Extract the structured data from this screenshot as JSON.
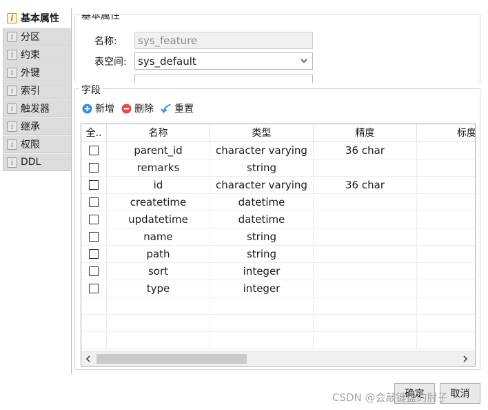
{
  "tabs": [
    {
      "label": "基本属性",
      "active": true,
      "icon": "info-icon"
    },
    {
      "label": "分区",
      "active": false,
      "icon": "info-icon"
    },
    {
      "label": "约束",
      "active": false,
      "icon": "info-icon"
    },
    {
      "label": "外键",
      "active": false,
      "icon": "info-icon"
    },
    {
      "label": "索引",
      "active": false,
      "icon": "info-icon"
    },
    {
      "label": "触发器",
      "active": false,
      "icon": "info-icon"
    },
    {
      "label": "继承",
      "active": false,
      "icon": "info-icon"
    },
    {
      "label": "权限",
      "active": false,
      "icon": "info-icon"
    },
    {
      "label": "DDL",
      "active": false,
      "icon": "info-icon"
    }
  ],
  "basic": {
    "legend": "基本属性",
    "name_label": "名称:",
    "name_value": "sys_feature",
    "tablespace_label": "表空间:",
    "tablespace_value": "sys_default"
  },
  "fields": {
    "legend": "字段",
    "toolbar": {
      "add": "新增",
      "delete": "删除",
      "reset": "重置"
    },
    "columns": [
      "全..",
      "名称",
      "类型",
      "精度",
      "标度"
    ],
    "rows": [
      {
        "name": "parent_id",
        "type": "character varying",
        "precision": "36 char"
      },
      {
        "name": "remarks",
        "type": "string",
        "precision": ""
      },
      {
        "name": "id",
        "type": "character varying",
        "precision": "36 char"
      },
      {
        "name": "createtime",
        "type": "datetime",
        "precision": ""
      },
      {
        "name": "updatetime",
        "type": "datetime",
        "precision": ""
      },
      {
        "name": "name",
        "type": "string",
        "precision": ""
      },
      {
        "name": "path",
        "type": "string",
        "precision": ""
      },
      {
        "name": "sort",
        "type": "integer",
        "precision": ""
      },
      {
        "name": "type",
        "type": "integer",
        "precision": ""
      }
    ]
  },
  "buttons": {
    "ok": "确定",
    "cancel": "取消"
  },
  "watermark": "CSDN @会敲键盘的肘子",
  "colors": {
    "active_icon": "#d67900",
    "add_icon": "#3a8ee6",
    "delete_icon": "#e24b4b",
    "reset_icon": "#3a8ee6"
  }
}
